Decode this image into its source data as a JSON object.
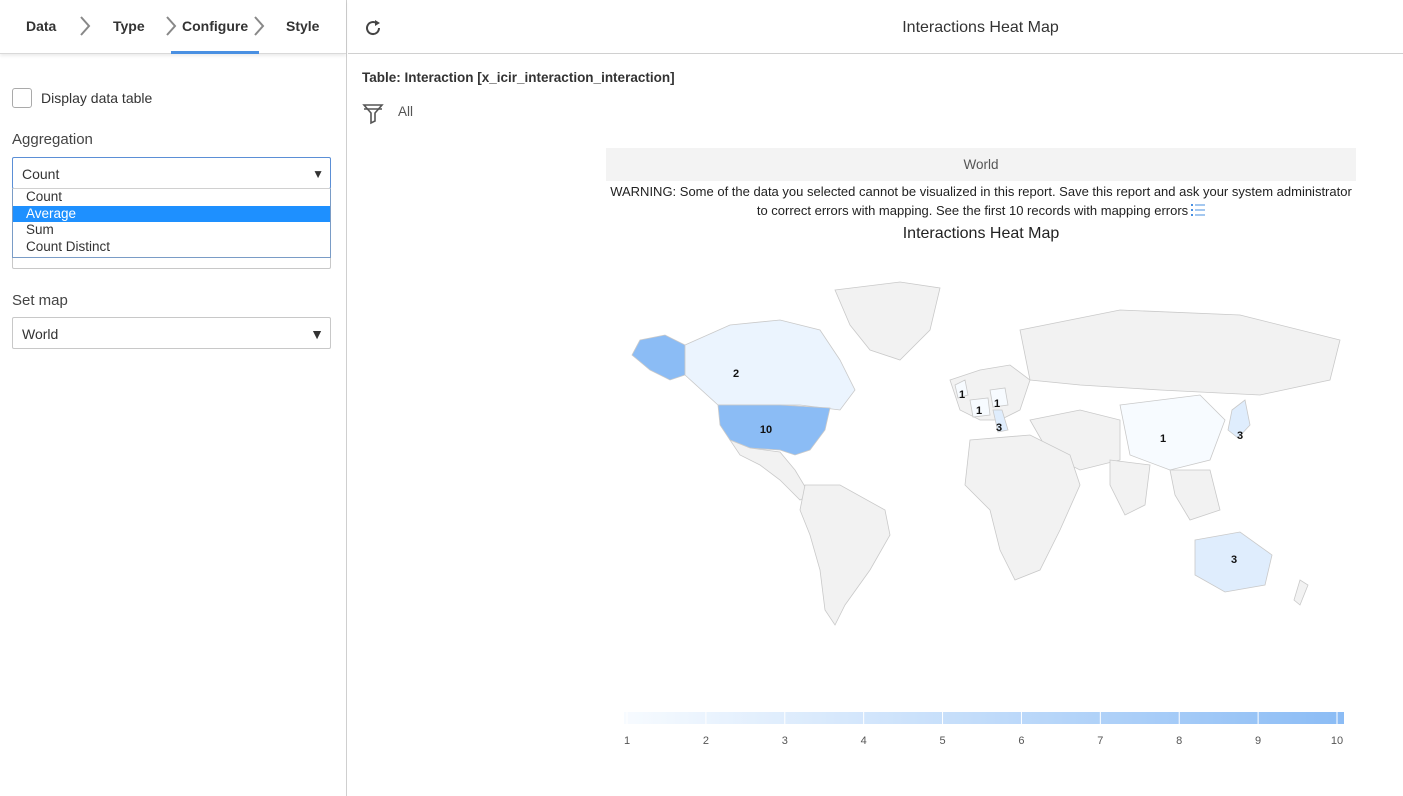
{
  "wizard": {
    "steps": [
      {
        "label": "Data"
      },
      {
        "label": "Type"
      },
      {
        "label": "Configure"
      },
      {
        "label": "Style"
      }
    ]
  },
  "config": {
    "display_table_label": "Display data table",
    "aggregation_label": "Aggregation",
    "aggregation_value": "Count",
    "aggregation_options": [
      "Count",
      "Average",
      "Sum",
      "Count Distinct"
    ],
    "aggregation_highlighted": "Average",
    "set_map_label": "Set map",
    "set_map_value": "World"
  },
  "report": {
    "title": "Interactions Heat Map",
    "table_line": "Table: Interaction [x_icir_interaction_interaction]",
    "filter_text": "All",
    "map_header": "World",
    "warning_line1": "WARNING: Some of the data you selected cannot be visualized in this report. Save this report and ask your system administrator",
    "warning_line2": "to correct errors with mapping. See the first 10 records with mapping errors",
    "chart_title": "Interactions Heat Map"
  },
  "colors": {
    "accent": "#4a90e2",
    "highlight": "#1e90ff",
    "scale_low": "#f7fbff",
    "scale_high": "#8bbcf5",
    "land": "#f2f2f2",
    "border": "#c9c9c9"
  },
  "chart_data": {
    "type": "heatmap",
    "title": "Interactions Heat Map",
    "map": "World",
    "regions": [
      {
        "label": "10",
        "value": 10
      },
      {
        "label": "2",
        "value": 2
      },
      {
        "label": "1",
        "value": 1
      },
      {
        "label": "1",
        "value": 1
      },
      {
        "label": "1",
        "value": 1
      },
      {
        "label": "3",
        "value": 3
      },
      {
        "label": "1",
        "value": 1
      },
      {
        "label": "3",
        "value": 3
      },
      {
        "label": "3",
        "value": 3
      }
    ],
    "legend": {
      "min": 1,
      "max": 10,
      "ticks": [
        "1",
        "2",
        "3",
        "4",
        "5",
        "6",
        "7",
        "8",
        "9",
        "10"
      ]
    }
  }
}
